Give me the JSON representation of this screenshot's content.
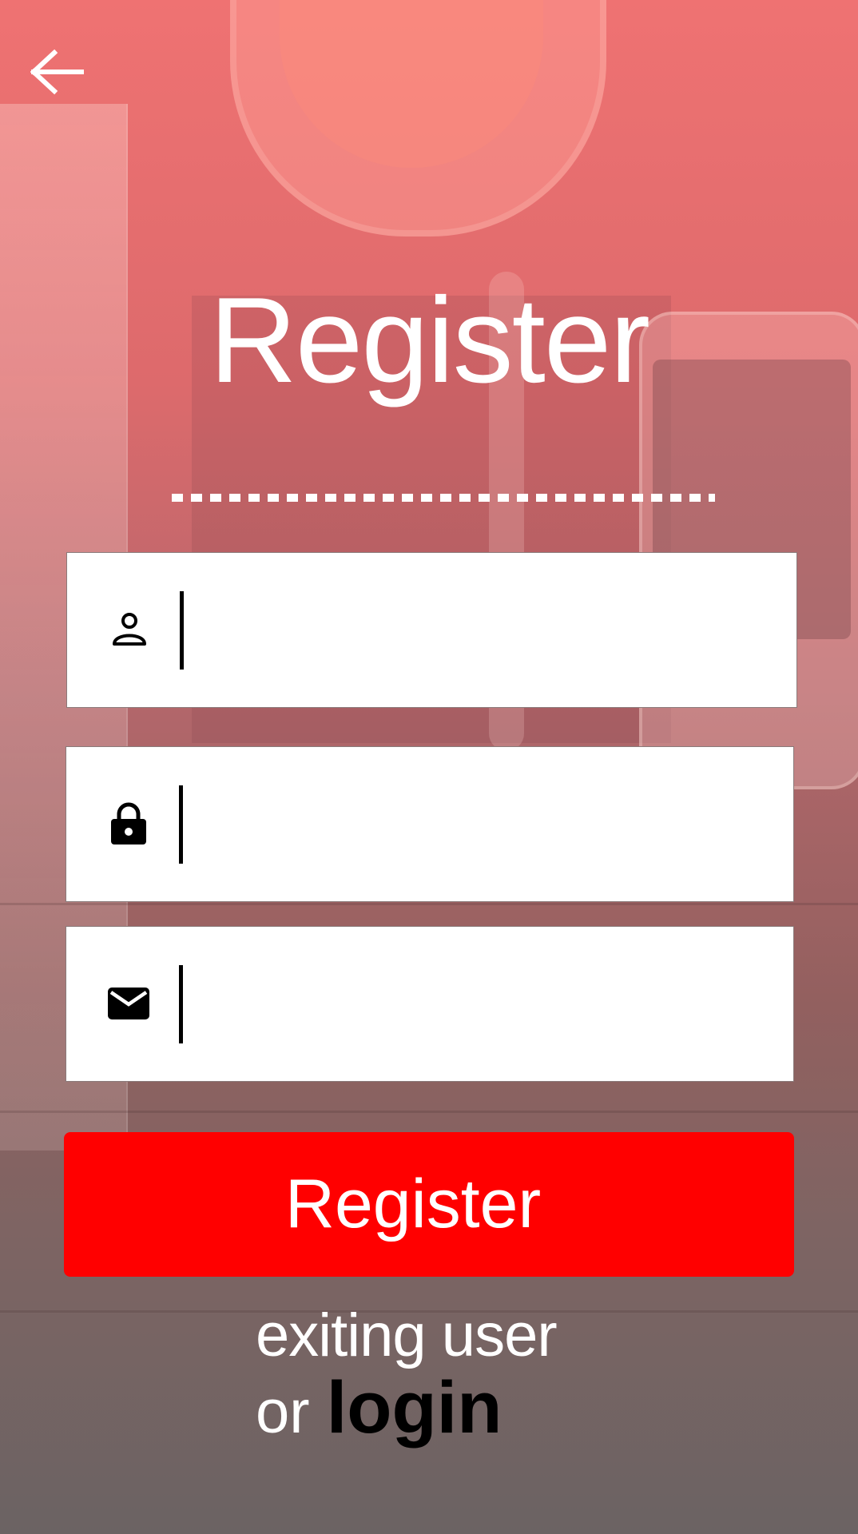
{
  "header": {
    "back_icon": "arrow-left-icon"
  },
  "title": "Register",
  "form": {
    "username": {
      "icon": "person-icon",
      "value": "",
      "placeholder": ""
    },
    "password": {
      "icon": "lock-icon",
      "value": "",
      "placeholder": ""
    },
    "email": {
      "icon": "mail-icon",
      "value": "",
      "placeholder": ""
    }
  },
  "register_button": {
    "label": "Register"
  },
  "footer": {
    "line1": "exiting user",
    "or": "or",
    "login_link": "login"
  },
  "colors": {
    "accent": "#ff0000",
    "text_light": "#ffffff",
    "text_dark": "#000000"
  }
}
